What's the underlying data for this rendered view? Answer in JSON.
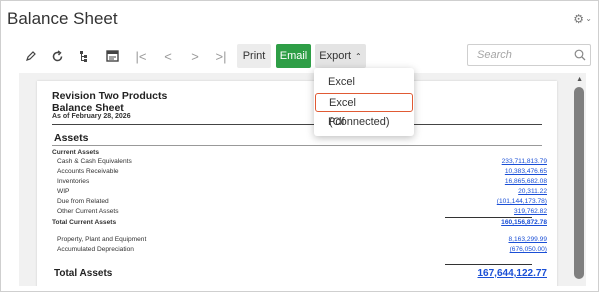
{
  "header": {
    "title": "Balance Sheet"
  },
  "toolbar": {
    "icons": [
      "pencil-icon",
      "refresh-icon",
      "hierarchy-icon",
      "layout-icon",
      "first-page-icon",
      "previous-page-icon",
      "next-page-icon",
      "last-page-icon"
    ],
    "print_label": "Print",
    "email_label": "Email",
    "export_label": "Export",
    "search_placeholder": "Search",
    "email_color": "#2e9e46"
  },
  "export_menu": {
    "items": [
      "Excel",
      "Excel (Connected)",
      "Pdf"
    ],
    "highlighted": "Excel (Connected)",
    "highlight_color": "#e05a34"
  },
  "report": {
    "company": "Revision Two Products",
    "title": "Balance Sheet",
    "as_of": "As of   February 28, 2026",
    "section_assets": "Assets",
    "current_assets_header": "Current Assets",
    "rows": [
      {
        "label": "Cash & Cash Equivalents",
        "value": "233,711,813.79"
      },
      {
        "label": "Accounts Receivable",
        "value": "10,383,476.65"
      },
      {
        "label": "Inventories",
        "value": "16,865,682.08"
      },
      {
        "label": "WIP",
        "value": "20,311.22"
      },
      {
        "label": "Due from Related",
        "value": "(101,144,173.78)"
      },
      {
        "label": "Other Current Assets",
        "value": "319,762.82"
      }
    ],
    "total_current_label": "Total Current Assets",
    "total_current_value": "160,156,872.78",
    "ppe_label": "Property, Plant and Equipment",
    "ppe_value": "8,163,299.99",
    "dep_label": "Accumulated Depreciation",
    "dep_value": "(676,050.00)",
    "total_assets_label": "Total Assets",
    "total_assets_value": "167,644,122.77",
    "link_color": "#1a4fd6"
  }
}
